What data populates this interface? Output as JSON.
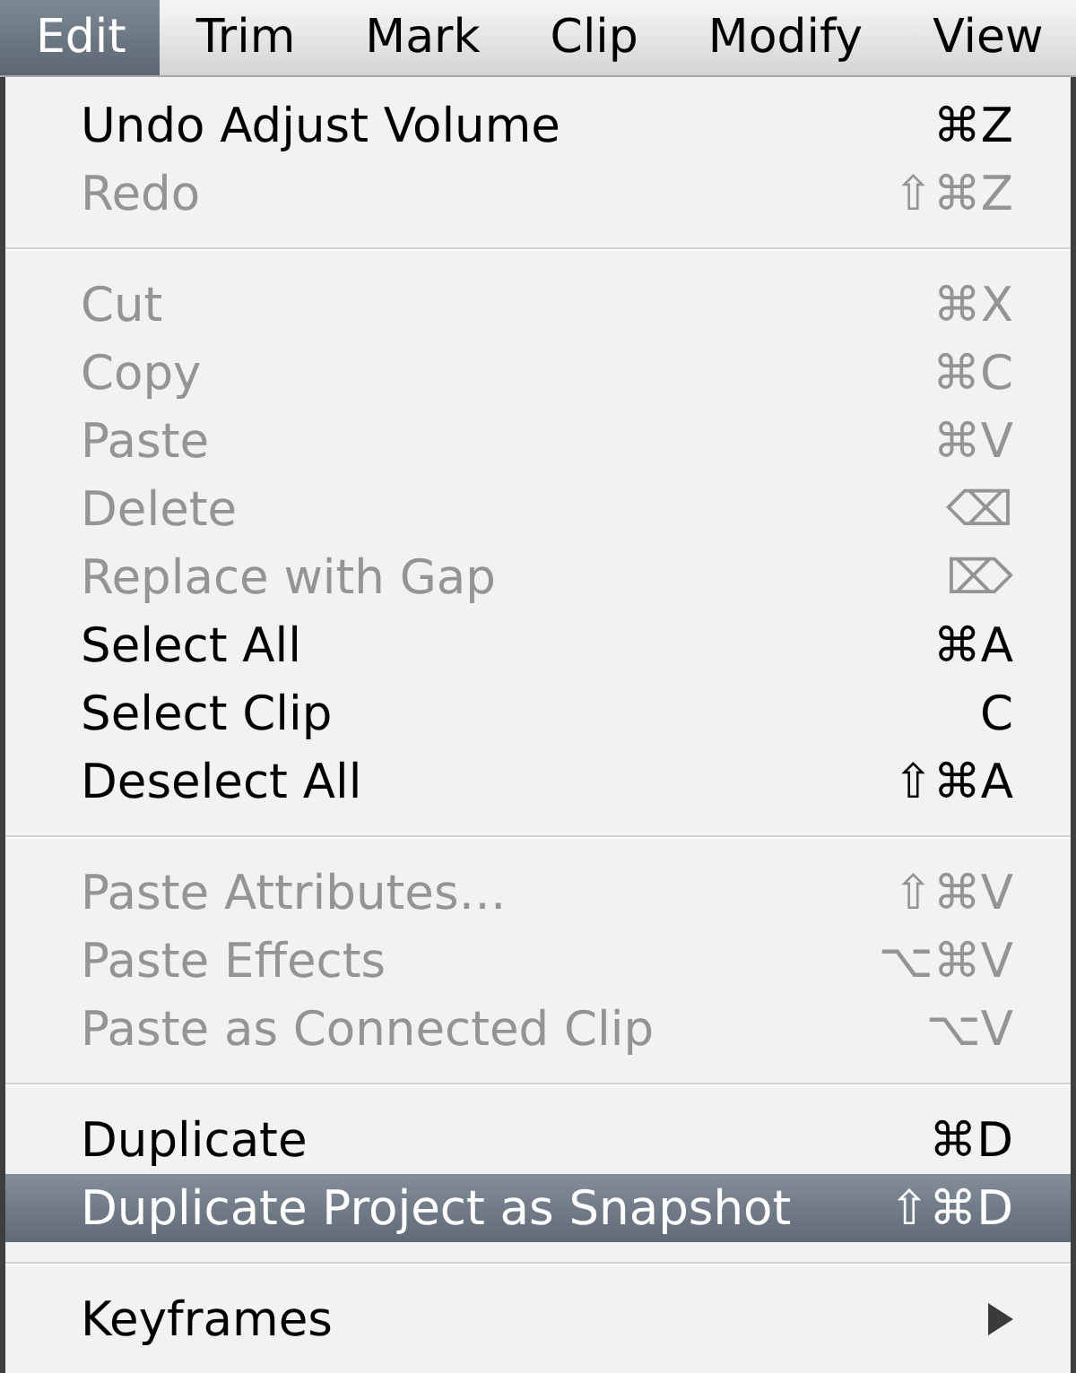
{
  "menu_bar": {
    "items": [
      {
        "label": "Edit",
        "selected": true
      },
      {
        "label": "Trim",
        "selected": false
      },
      {
        "label": "Mark",
        "selected": false
      },
      {
        "label": "Clip",
        "selected": false
      },
      {
        "label": "Modify",
        "selected": false
      },
      {
        "label": "View",
        "selected": false
      }
    ]
  },
  "menu": {
    "sections": [
      {
        "items": [
          {
            "kind": "command",
            "label": "Undo Adjust Volume",
            "shortcut": "⌘Z",
            "disabled": false,
            "selected": false
          },
          {
            "kind": "command",
            "label": "Redo",
            "shortcut": "⇧⌘Z",
            "disabled": true,
            "selected": false
          }
        ]
      },
      {
        "items": [
          {
            "kind": "command",
            "label": "Cut",
            "shortcut": "⌘X",
            "disabled": true,
            "selected": false
          },
          {
            "kind": "command",
            "label": "Copy",
            "shortcut": "⌘C",
            "disabled": true,
            "selected": false
          },
          {
            "kind": "command",
            "label": "Paste",
            "shortcut": "⌘V",
            "disabled": true,
            "selected": false
          },
          {
            "kind": "command",
            "label": "Delete",
            "shortcut": "⌫",
            "disabled": true,
            "selected": false
          },
          {
            "kind": "command",
            "label": "Replace with Gap",
            "shortcut": "⌦",
            "disabled": true,
            "selected": false
          },
          {
            "kind": "command",
            "label": "Select All",
            "shortcut": "⌘A",
            "disabled": false,
            "selected": false
          },
          {
            "kind": "command",
            "label": "Select Clip",
            "shortcut": "C",
            "disabled": false,
            "selected": false
          },
          {
            "kind": "command",
            "label": "Deselect All",
            "shortcut": "⇧⌘A",
            "disabled": false,
            "selected": false
          }
        ]
      },
      {
        "items": [
          {
            "kind": "command",
            "label": "Paste Attributes…",
            "shortcut": "⇧⌘V",
            "disabled": true,
            "selected": false
          },
          {
            "kind": "command",
            "label": "Paste Effects",
            "shortcut": "⌥⌘V",
            "disabled": true,
            "selected": false
          },
          {
            "kind": "command",
            "label": "Paste as Connected Clip",
            "shortcut": "⌥V",
            "disabled": true,
            "selected": false
          }
        ]
      },
      {
        "items": [
          {
            "kind": "command",
            "label": "Duplicate",
            "shortcut": "⌘D",
            "disabled": false,
            "selected": false
          },
          {
            "kind": "command",
            "label": "Duplicate Project as Snapshot",
            "shortcut": "⇧⌘D",
            "disabled": false,
            "selected": true
          }
        ]
      },
      {
        "items": [
          {
            "kind": "submenu",
            "label": "Keyframes",
            "disabled": false,
            "selected": false
          }
        ]
      }
    ]
  }
}
